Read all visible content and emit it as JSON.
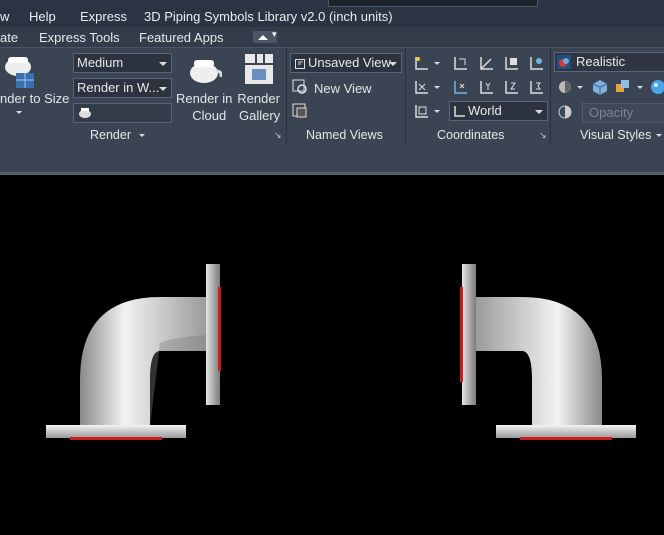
{
  "titlebar": {
    "menus": [
      "w",
      "Help",
      "Express",
      "3D Piping Symbols Library v2.0 (inch units)"
    ]
  },
  "tabs": [
    "ate",
    "Express Tools",
    "Featured Apps"
  ],
  "render_panel": {
    "render_to_size_label": "nder to Size",
    "quality_value": "Medium",
    "render_in_value": "Render in W...",
    "render_in_cloud_line1": "Render in",
    "render_in_cloud_line2": "Cloud",
    "render_gallery_line1": "Render",
    "render_gallery_line2": "Gallery",
    "title": "Render"
  },
  "named_views_panel": {
    "current_view": "Unsaved View",
    "new_view_label": "New View",
    "title": "Named Views"
  },
  "coordinates_panel": {
    "ucs_value": "World",
    "title": "Coordinates"
  },
  "visual_styles_panel": {
    "style_value": "Realistic",
    "opacity_placeholder": "Opacity",
    "title": "Visual Styles"
  },
  "colors": {
    "ribbon_bg": "#3b4453",
    "flange_seal": "#c81e1e",
    "pipe_light": "#f2f2f2",
    "pipe_dark": "#8a8a8a"
  }
}
